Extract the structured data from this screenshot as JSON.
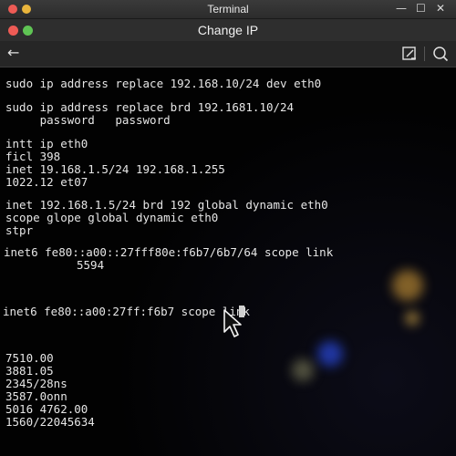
{
  "window": {
    "title": "Terminal",
    "controls": {
      "minimize": "—",
      "maximize": "☐",
      "close": "✕"
    }
  },
  "app": {
    "title": "Change IP",
    "back_icon": "arrow-left-icon",
    "edit_icon": "edit-icon",
    "search_icon": "search-icon"
  },
  "terminal": {
    "lines": [
      "sudo ip address replace 192.168.10/24 dev eth0",
      "sudo ip address replace brd 192.1681.10/24",
      "     password   password",
      "intt ip eth0",
      "ficl 398",
      "inet 19.168.1.5/24 192.168.1.255",
      "1022.12 et07",
      "inet 192.168.1.5/24 brd 192 global dynamic eth0",
      "scope glope global dynamic eth0",
      "stpr",
      "inet6 fe80::a00::27fff80e:f6b7/6b7/64 scope link",
      "5594",
      "inet6 fe80::a00:27ff:f6b7 scope link",
      "7510.00",
      "3881.05",
      "2345/28ns",
      "3587.0onn",
      "5016 4762.00",
      "1560/22045634"
    ]
  },
  "colors": {
    "background": "#050505",
    "text": "#e6e6e6",
    "close_dot": "#ee5b55",
    "minimize_dot": "#e9b53c",
    "zoom_dot": "#5fc454"
  }
}
